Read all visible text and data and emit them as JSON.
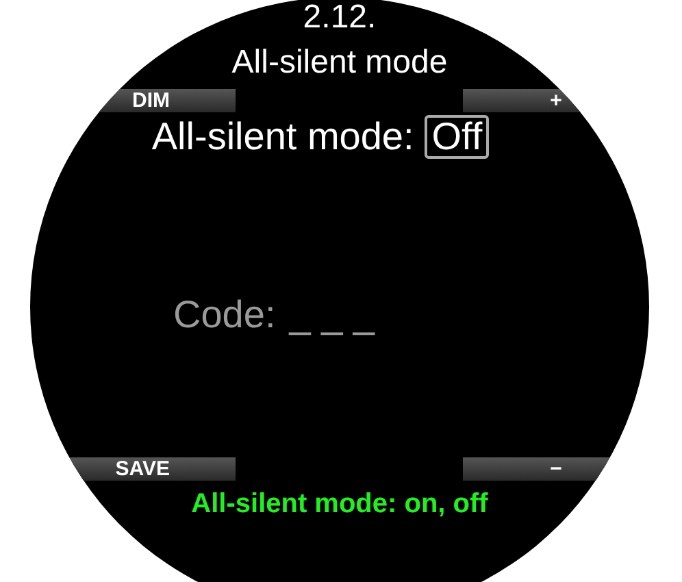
{
  "screen": {
    "number": "2.12.",
    "title": "All-silent mode",
    "top_keys": [
      {
        "label": "DIM"
      },
      {
        "label": "+"
      }
    ],
    "setting": {
      "label": "All-silent mode:",
      "value": "Off",
      "selected": true
    },
    "code": {
      "label": "Code:",
      "value": "_ _ _",
      "disabled": true
    },
    "bottom_keys": [
      {
        "label": "SAVE"
      },
      {
        "label": "−"
      }
    ],
    "hint": "All-silent mode: on, off"
  }
}
